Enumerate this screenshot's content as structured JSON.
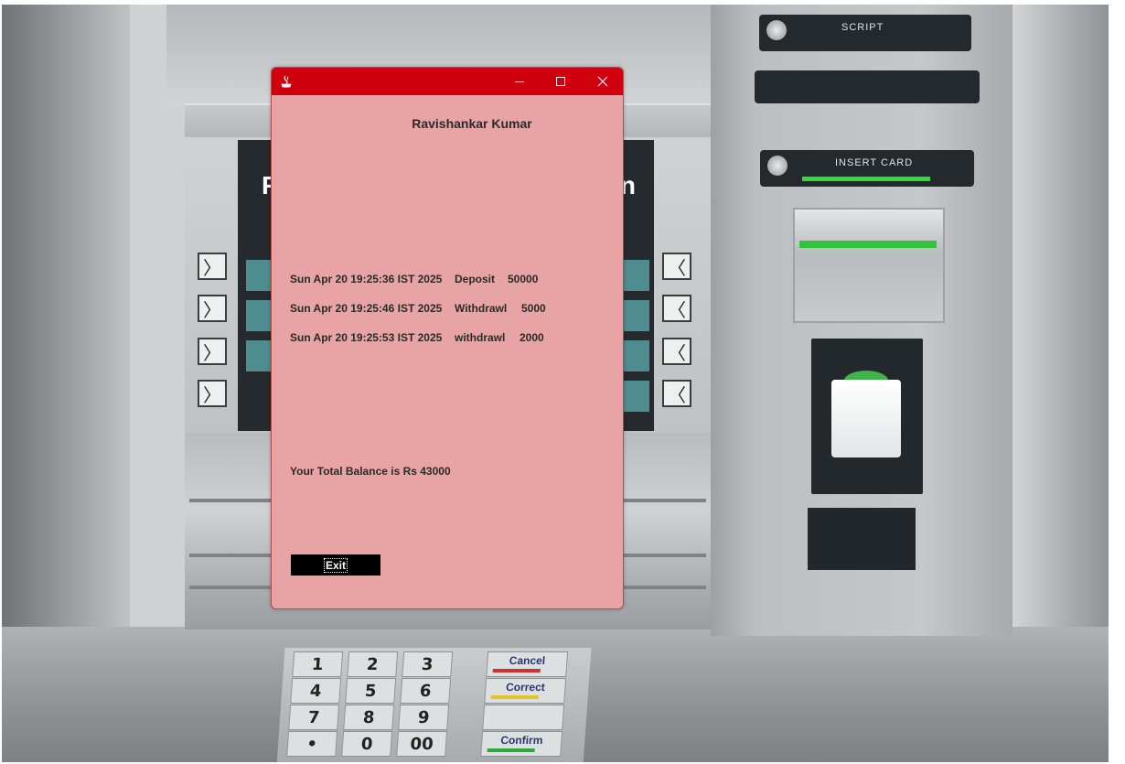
{
  "background": {
    "screen_title_left": "F",
    "screen_title_right": "on",
    "side_key_left_glyph": "〉",
    "side_key_right_glyph": "〈",
    "panel_labels": [
      "SCRIPT",
      "INSERT CARD"
    ],
    "keypad": {
      "digits": [
        "1",
        "2",
        "3",
        "4",
        "5",
        "6",
        "7",
        "8",
        "9",
        "•",
        "0",
        "00"
      ],
      "function_keys": [
        "Cancel",
        "Correct",
        "",
        "Confirm"
      ]
    }
  },
  "window": {
    "account_name": "Ravishankar Kumar",
    "transactions": [
      {
        "date": "Sun Apr 20 19:25:36 IST 2025",
        "type": "Deposit",
        "amount": "50000"
      },
      {
        "date": "Sun Apr 20 19:25:46 IST 2025",
        "type": "Withdrawl",
        "amount": "5000"
      },
      {
        "date": "Sun Apr 20 19:25:53 IST 2025",
        "type": "withdrawl",
        "amount": "2000"
      }
    ],
    "balance_text": "Your Total Balance is Rs 43000",
    "exit_label": "Exit"
  },
  "colors": {
    "title_bar": "#d0000f",
    "window_bg": "#e8a4a4",
    "exit_button_bg": "#000000",
    "exit_button_text": "#ffffff"
  }
}
